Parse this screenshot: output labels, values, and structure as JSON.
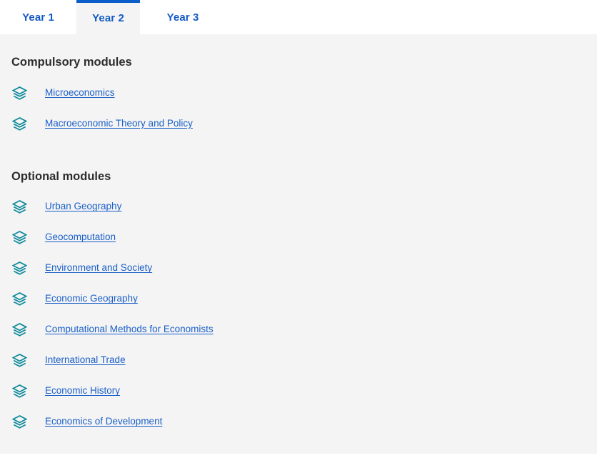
{
  "tabs": [
    {
      "label": "Year 1",
      "active": false
    },
    {
      "label": "Year 2",
      "active": true
    },
    {
      "label": "Year 3",
      "active": false
    }
  ],
  "sections": {
    "compulsory": {
      "heading": "Compulsory modules",
      "modules": [
        {
          "name": "Microeconomics",
          "icon": "layers-icon"
        },
        {
          "name": "Macroeconomic Theory and Policy",
          "icon": "layers-icon"
        }
      ]
    },
    "optional": {
      "heading": "Optional modules",
      "modules": [
        {
          "name": "Urban Geography",
          "icon": "layers-icon"
        },
        {
          "name": "Geocomputation",
          "icon": "layers-icon"
        },
        {
          "name": "Environment and Society",
          "icon": "layers-icon"
        },
        {
          "name": "Economic Geography",
          "icon": "layers-icon"
        },
        {
          "name": "Computational Methods for Economists",
          "icon": "layers-icon"
        },
        {
          "name": "International Trade",
          "icon": "layers-icon"
        },
        {
          "name": "Economic History",
          "icon": "layers-icon"
        },
        {
          "name": "Economics of Development",
          "icon": "layers-icon"
        }
      ]
    }
  },
  "colors": {
    "tab_link": "#1359c6",
    "active_tab_border": "#0b5ec9",
    "active_tab_background": "#f4f4f4",
    "panel_background": "#f4f4f4",
    "heading_text": "#2d2d2d",
    "module_link": "#1a5fc8",
    "icon_teal": "#0f8a9b",
    "page_background": "#ffffff"
  }
}
